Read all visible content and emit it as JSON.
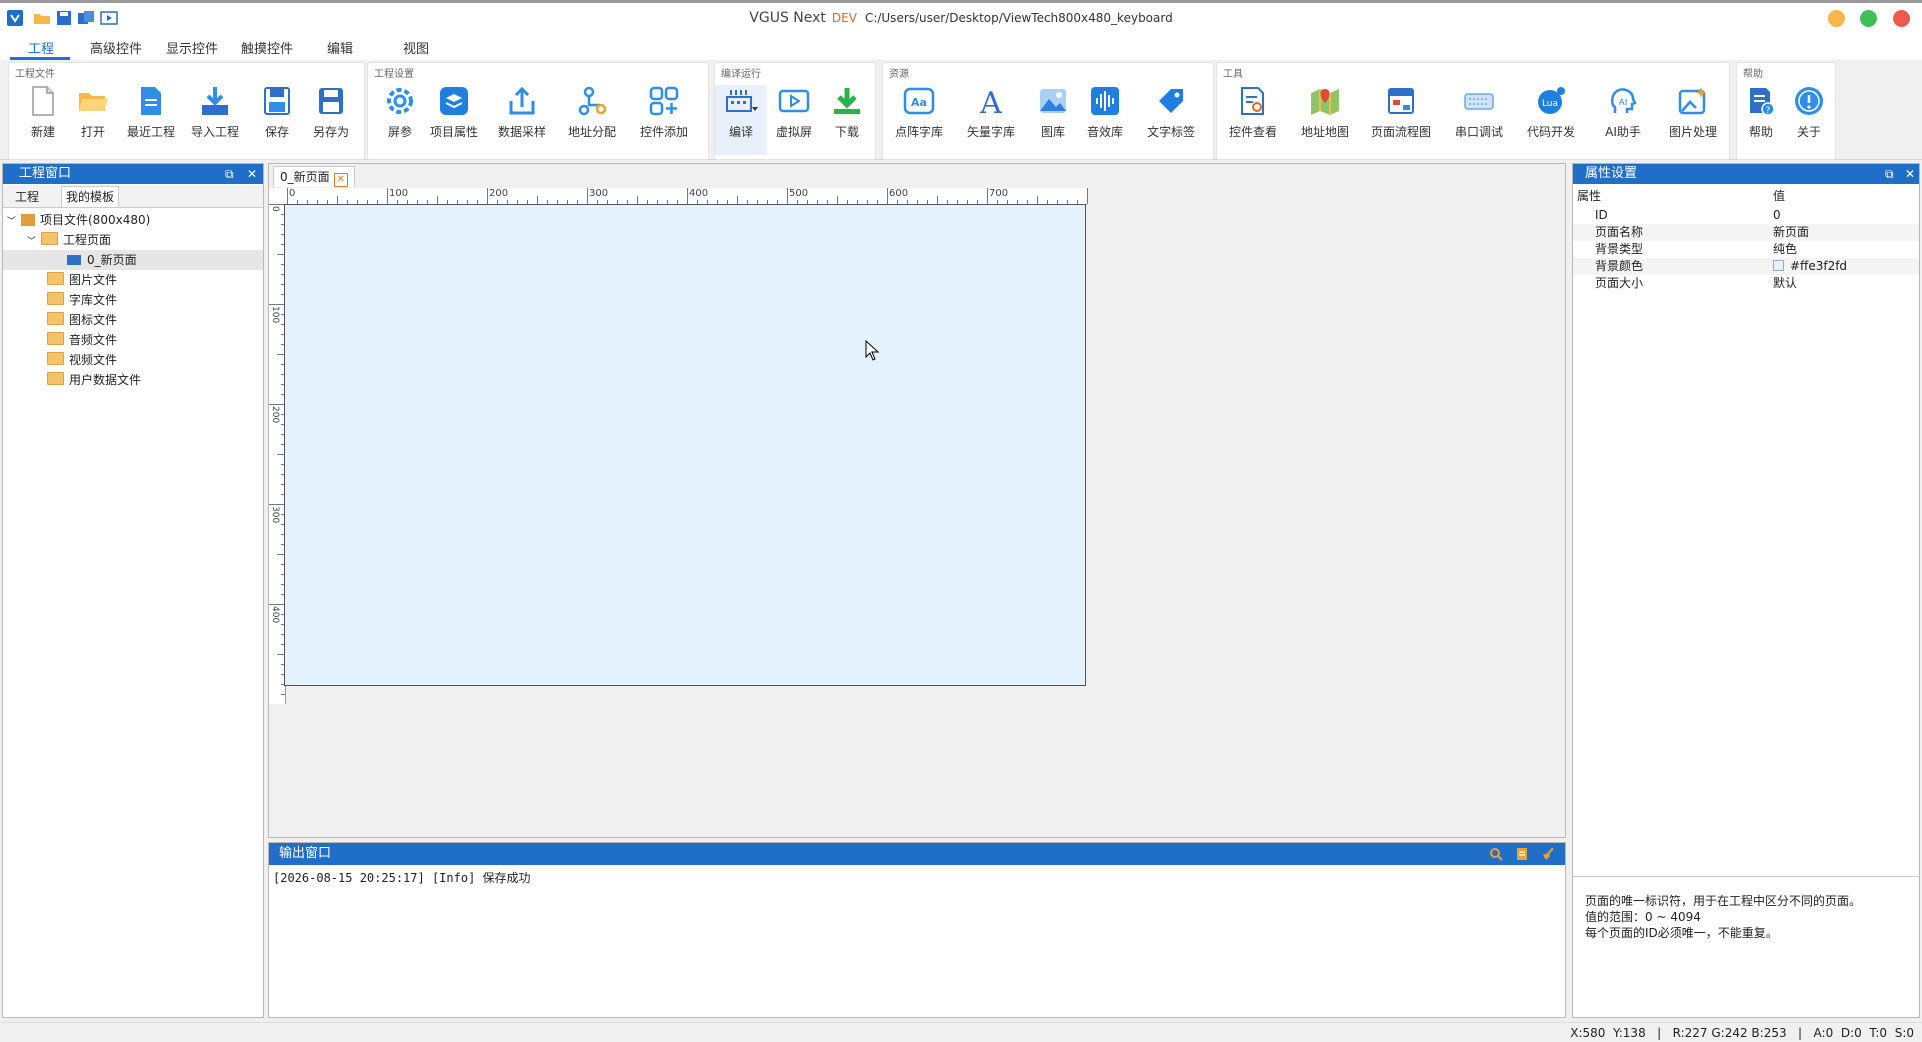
{
  "title": {
    "app": "VGUS Next",
    "badge": "DEV",
    "path": "C:/Users/user/Desktop/ViewTech800x480_keyboard"
  },
  "tabs": [
    "工程",
    "高级控件",
    "显示控件",
    "触摸控件",
    "编辑",
    "视图"
  ],
  "ribbon": {
    "groups": [
      {
        "title": "工程文件",
        "buttons": [
          "新建",
          "打开",
          "最近工程",
          "导入工程",
          "保存",
          "另存为"
        ]
      },
      {
        "title": "工程设置",
        "buttons": [
          "屏参",
          "项目属性",
          "数据采样",
          "地址分配",
          "控件添加"
        ]
      },
      {
        "title": "编译运行",
        "buttons": [
          "编译",
          "虚拟屏",
          "下载"
        ]
      },
      {
        "title": "资源",
        "buttons": [
          "点阵字库",
          "矢量字库",
          "图库",
          "音效库",
          "文字标签"
        ]
      },
      {
        "title": "工具",
        "buttons": [
          "控件查看",
          "地址地图",
          "页面流程图",
          "串口调试",
          "代码开发",
          "AI助手",
          "图片处理"
        ]
      },
      {
        "title": "帮助",
        "buttons": [
          "帮助",
          "关于"
        ]
      }
    ]
  },
  "left_panel": {
    "title": "工程窗口",
    "tabs": [
      "工程",
      "我的模板"
    ],
    "tree": {
      "root": "项目文件(800x480)",
      "pages_folder": "工程页面",
      "page": "0_新页面",
      "folders": [
        "图片文件",
        "字库文件",
        "图标文件",
        "音频文件",
        "视频文件",
        "用户数据文件"
      ]
    }
  },
  "document": {
    "tab_label": "0_新页面",
    "close_glyph": "✕",
    "ruler_h": [
      "0",
      "100",
      "200",
      "300",
      "400",
      "500",
      "600",
      "700"
    ],
    "ruler_v": [
      "0",
      "100",
      "200",
      "300",
      "400"
    ]
  },
  "output": {
    "title": "输出窗口",
    "log": "[2026-08-15 20:25:17] [Info] 保存成功"
  },
  "properties": {
    "title": "属性设置",
    "header_key": "属性",
    "header_value": "值",
    "rows": [
      {
        "k": "ID",
        "v": "0"
      },
      {
        "k": "页面名称",
        "v": "新页面"
      },
      {
        "k": "背景类型",
        "v": "纯色"
      },
      {
        "k": "背景颜色",
        "v": "#ffe3f2fd"
      },
      {
        "k": "页面大小",
        "v": "默认"
      }
    ],
    "description": [
      "页面的唯一标识符，用于在工程中区分不同的页面。",
      "值的范围：0 ~ 4094",
      "每个页面的ID必须唯一，不能重复。"
    ]
  },
  "status": "X:580  Y:138   |   R:227 G:242 B:253   |   A:0  D:0  T:0  S:0",
  "colors": {
    "accent": "#1f6fc8",
    "canvas_bg": "#e3f2fd",
    "dev": "#e06a1a"
  }
}
